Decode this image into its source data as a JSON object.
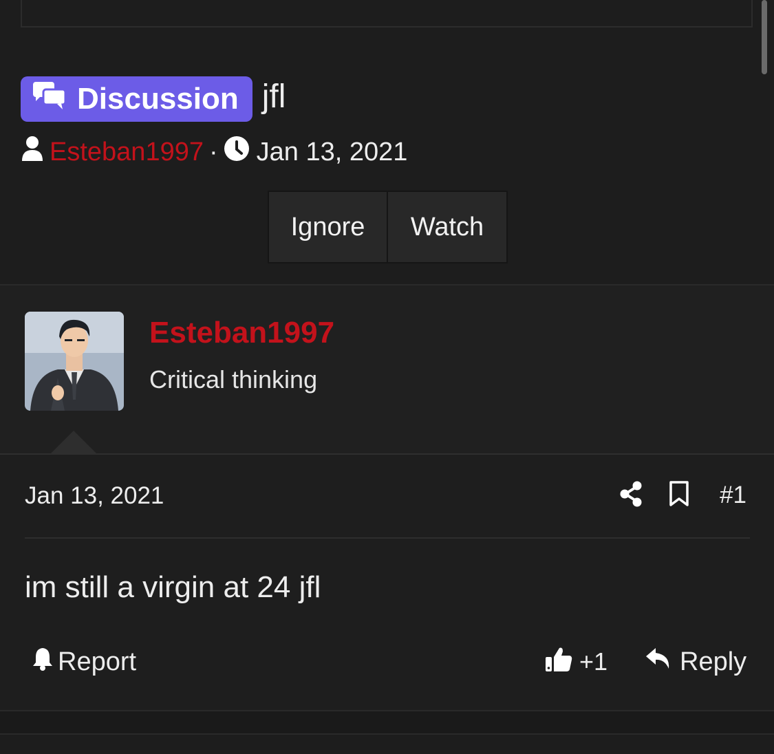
{
  "thread": {
    "prefix": "Discussion",
    "title": "jfl",
    "author": "Esteban1997",
    "separator": "·",
    "date": "Jan 13, 2021"
  },
  "buttons": {
    "ignore": "Ignore",
    "watch": "Watch"
  },
  "user": {
    "name": "Esteban1997",
    "title": "Critical thinking"
  },
  "post": {
    "date": "Jan 13, 2021",
    "number": "#1",
    "body": "im still a virgin at 24 jfl",
    "report": "Report",
    "likes": "+1",
    "reply": "Reply"
  },
  "colors": {
    "accent_prefix": "#6c5ce7",
    "username": "#c3121b",
    "background": "#1d1d1d"
  },
  "icons": [
    "comments-icon",
    "user-icon",
    "clock-icon",
    "share-icon",
    "bookmark-icon",
    "bell-icon",
    "thumbs-up-icon",
    "reply-icon"
  ]
}
